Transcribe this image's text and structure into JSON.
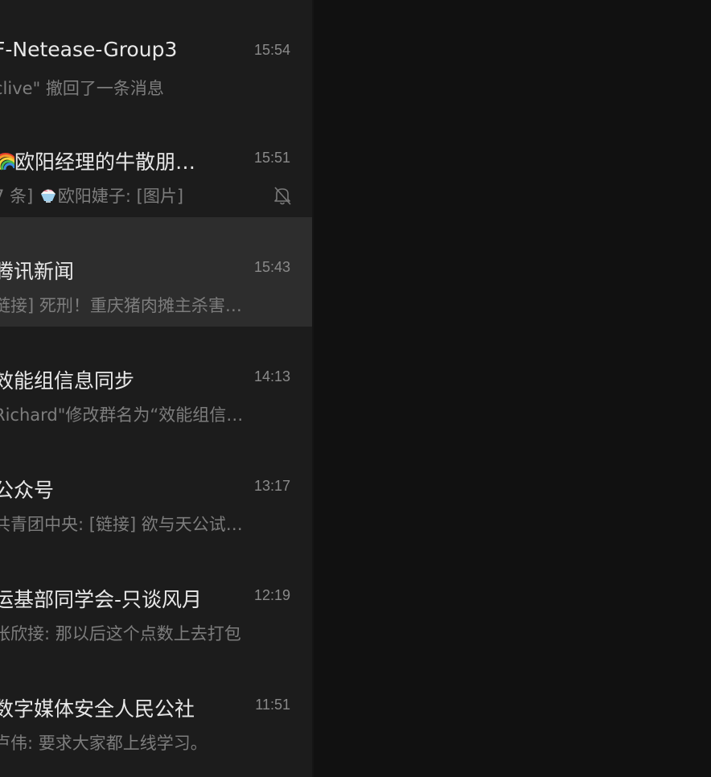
{
  "chats": [
    {
      "title": "F-Netease-Group3",
      "preview": "clive\" 撤回了一条消息",
      "time": "15:54",
      "muted": false,
      "selected": false
    },
    {
      "title": "欧阳经理的牛散朋…",
      "title_prefix_icon": "rainbow-emoji",
      "preview_a": "7 条]",
      "preview_icon": "shaved-ice-emoji",
      "preview_b": "欧阳婕子: [图片]",
      "time": "15:51",
      "muted": true,
      "selected": false
    },
    {
      "title": "腾讯新闻",
      "preview": "链接] 死刑！重庆猪肉摊主杀害…",
      "time": "15:43",
      "muted": false,
      "selected": true
    },
    {
      "title": "效能组信息同步",
      "preview": "Richard\"修改群名为“效能组信…",
      "time": "14:13",
      "muted": false,
      "selected": false
    },
    {
      "title": "公众号",
      "preview": "共青团中央: [链接] 欲与天公试…",
      "time": "13:17",
      "muted": false,
      "selected": false
    },
    {
      "title": "运基部同学会-只谈风月",
      "preview": "张欣接: 那以后这个点数上去打包",
      "time": "12:19",
      "muted": false,
      "selected": false
    },
    {
      "title": "数字媒体安全人民公社",
      "preview": "卢伟: 要求大家都上线学习。",
      "time": "11:51",
      "muted": false,
      "selected": false
    }
  ],
  "colors": {
    "list_bg": "#1c1c1c",
    "selected_bg": "#2d2d2d",
    "pane_bg": "#111111",
    "title": "#e8e8e8",
    "preview": "#7d7d7d",
    "time": "#8a8a8a"
  }
}
